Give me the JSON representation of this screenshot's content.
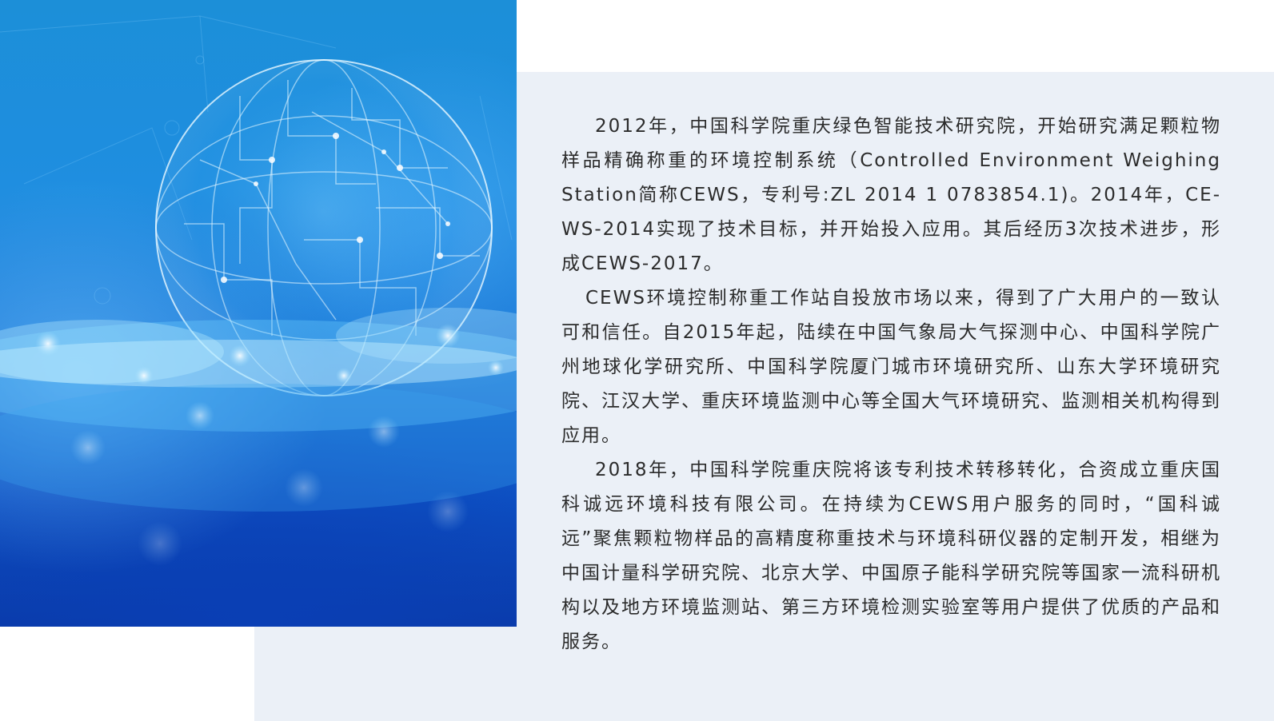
{
  "hero_image": {
    "icon": "globe-circuit-image",
    "colors": {
      "primary": "#1a7fd9",
      "deep": "#0a3aa8",
      "glow": "#9fe0ff"
    }
  },
  "article": {
    "paragraphs": [
      "2012年，中国科学院重庆绿色智能技术研究院，开始研究满足颗粒物样品精确称重的环境控制系统（Controlled Environment Weighing Station简称CEWS，专利号:ZL 2014 1 0783854.1)。2014年，CE-WS-2014实现了技术目标，并开始投入应用。其后经历3次技术进步，形成CEWS-2017。",
      "CEWS环境控制称重工作站自投放市场以来，得到了广大用户的一致认可和信任。自2015年起，陆续在中国气象局大气探测中心、中国科学院广州地球化学研究所、中国科学院厦门城市环境研究所、山东大学环境研究院、江汉大学、重庆环境监测中心等全国大气环境研究、监测相关机构得到应用。",
      "2018年，中国科学院重庆院将该专利技术转移转化，合资成立重庆国科诚远环境科技有限公司。在持续为CEWS用户服务的同时，“国科诚远”聚焦颗粒物样品的高精度称重技术与环境科研仪器的定制开发，相继为中国计量科学研究院、北京大学、中国原子能科学研究院等国家一流科研机构以及地方环境监测站、第三方环境检测实验室等用户提供了优质的产品和服务。"
    ]
  },
  "colors": {
    "panel_background": "#ebf0f7",
    "text": "#2b2b2b"
  }
}
